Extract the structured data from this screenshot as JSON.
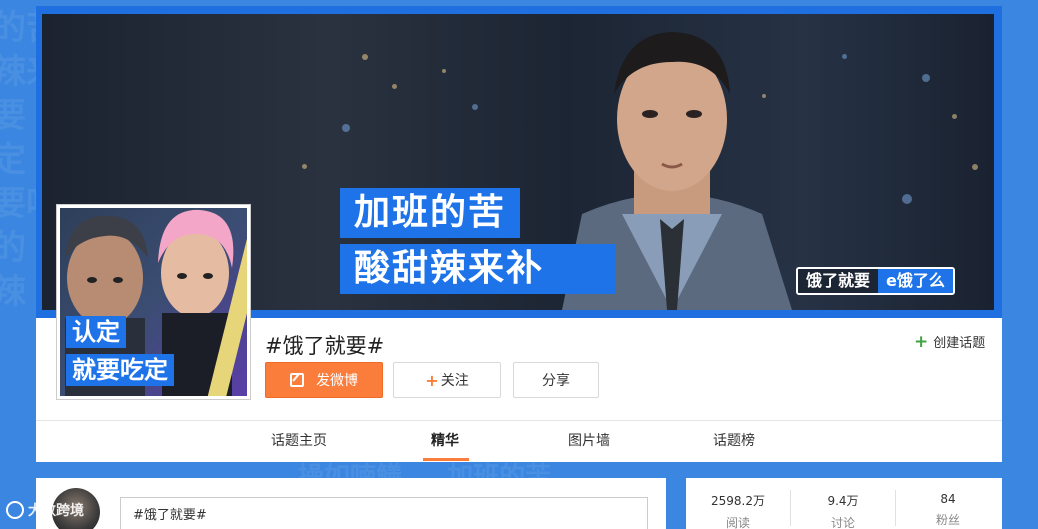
{
  "banner": {
    "slogan_line1": "加班的苦",
    "slogan_line2": "酸甜辣来补",
    "brand_tag": "饿了就要",
    "brand_logo": "e饿了么"
  },
  "avatar": {
    "line1": "认定",
    "line2": "就要吃定"
  },
  "topic": {
    "title": "#饿了就要#",
    "create_label": "创建话题"
  },
  "actions": {
    "post_label": "发微博",
    "follow_label": "关注",
    "share_label": "分享"
  },
  "tabs": [
    {
      "label": "话题主页"
    },
    {
      "label": "精华"
    },
    {
      "label": "图片墙"
    },
    {
      "label": "话题榜"
    }
  ],
  "feed": {
    "input_value": "#饿了就要#"
  },
  "stats": [
    {
      "value": "2598.2万",
      "label": "阅读"
    },
    {
      "value": "9.4万",
      "label": "讨论"
    },
    {
      "value": "84",
      "label": "粉丝"
    }
  ],
  "watermark": {
    "text": "大数跨境"
  },
  "colors": {
    "page_bg": "#3a86e0",
    "accent_orange": "#fa7d3c",
    "brand_blue": "#1e73e8",
    "green_plus": "#3fa33f"
  }
}
